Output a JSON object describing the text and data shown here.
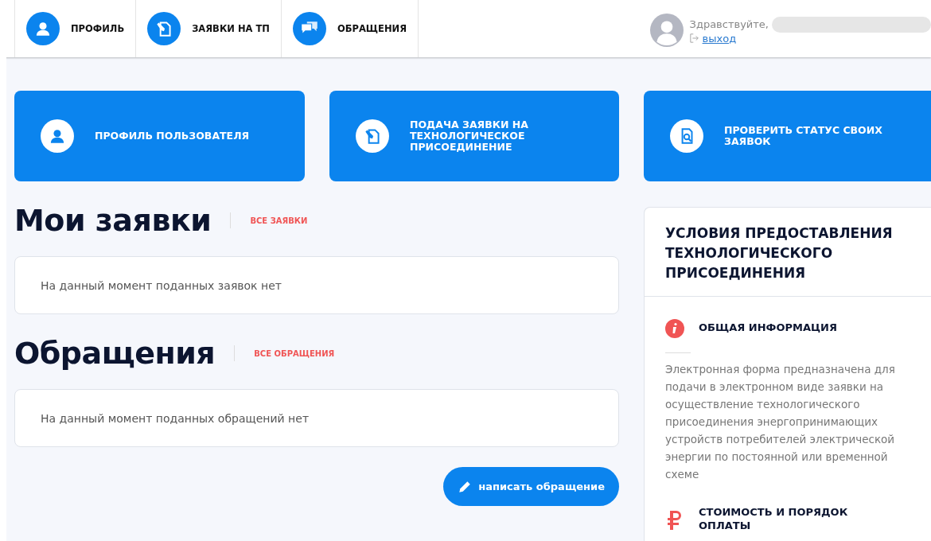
{
  "nav": {
    "items": [
      {
        "label": "ПРОФИЛЬ"
      },
      {
        "label": "ЗАЯВКИ НА ТП"
      },
      {
        "label": "ОБРАЩЕНИЯ"
      }
    ],
    "user": {
      "greeting": "Здравствуйте,",
      "logout": "выход"
    }
  },
  "tiles": [
    {
      "label": "ПРОФИЛЬ ПОЛЬЗОВАТЕЛЯ"
    },
    {
      "label": "ПОДАЧА ЗАЯВКИ НА ТЕХНОЛОГИЧЕСКОЕ ПРИСОЕДИНЕНИЕ"
    },
    {
      "label": "ПРОВЕРИТЬ СТАТУС СВОИХ ЗАЯВОК"
    }
  ],
  "sections": [
    {
      "title": "Мои заявки",
      "link": "ВСЕ ЗАЯВКИ",
      "empty_text": "На данный момент поданных заявок нет"
    },
    {
      "title": "Обращения",
      "link": "ВСЕ ОБРАЩЕНИЯ",
      "empty_text": "На данный момент поданных обращений нет"
    }
  ],
  "write_button": "написать обращение",
  "conditions": {
    "title": "УСЛОВИЯ ПРЕДОСТАВЛЕНИЯ ТЕХНОЛОГИЧЕСКОГО ПРИСОЕДИНЕНИЯ",
    "blocks": [
      {
        "title": "ОБЩАЯ ИНФОРМАЦИЯ",
        "text": "Электронная форма предназначена для подачи в электронном виде заявки на осуществление технологического присоединения энергопринимающих устройств потребителей электрической энергии по постоянной или временной схеме"
      },
      {
        "title": "СТОИМОСТЬ И ПОРЯДОК ОПЛАТЫ"
      }
    ]
  }
}
